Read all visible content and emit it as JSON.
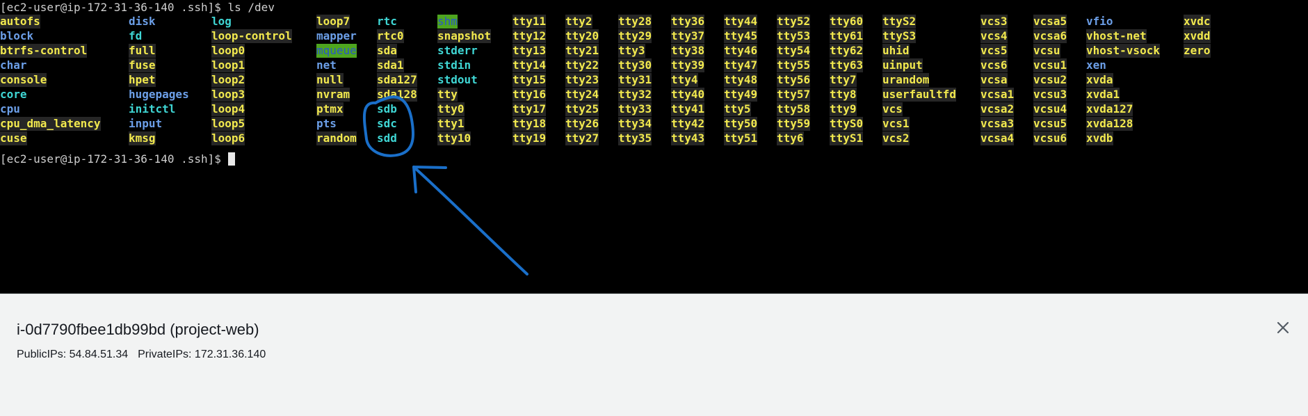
{
  "terminal": {
    "prompt_line": "[ec2-user@ip-172-31-36-140 .ssh]$ ls /dev",
    "final_prompt": "[ec2-user@ip-172-31-36-140 .ssh]$ ",
    "rows_per_column": 9,
    "columns": [
      [
        [
          "autofs",
          "dev"
        ],
        [
          "block",
          "dir"
        ],
        [
          "btrfs-control",
          "dev"
        ],
        [
          "char",
          "dir"
        ],
        [
          "console",
          "dev"
        ],
        [
          "core",
          "link"
        ],
        [
          "cpu",
          "dir"
        ],
        [
          "cpu_dma_latency",
          "dev"
        ],
        [
          "cuse",
          "dev"
        ]
      ],
      [
        [
          "disk",
          "dir"
        ],
        [
          "fd",
          "link"
        ],
        [
          "full",
          "dev"
        ],
        [
          "fuse",
          "dev"
        ],
        [
          "hpet",
          "dev"
        ],
        [
          "hugepages",
          "dir"
        ],
        [
          "initctl",
          "link"
        ],
        [
          "input",
          "dir"
        ],
        [
          "kmsg",
          "dev"
        ]
      ],
      [
        [
          "log",
          "link"
        ],
        [
          "loop-control",
          "dev"
        ],
        [
          "loop0",
          "dev"
        ],
        [
          "loop1",
          "dev"
        ],
        [
          "loop2",
          "dev"
        ],
        [
          "loop3",
          "dev"
        ],
        [
          "loop4",
          "dev"
        ],
        [
          "loop5",
          "dev"
        ],
        [
          "loop6",
          "dev"
        ]
      ],
      [
        [
          "loop7",
          "dev"
        ],
        [
          "mapper",
          "dir"
        ],
        [
          "mqueue",
          "sticky"
        ],
        [
          "net",
          "dir"
        ],
        [
          "null",
          "dev"
        ],
        [
          "nvram",
          "dev"
        ],
        [
          "ptmx",
          "dev"
        ],
        [
          "pts",
          "dir"
        ],
        [
          "random",
          "dev"
        ]
      ],
      [
        [
          "rtc",
          "link"
        ],
        [
          "rtc0",
          "dev"
        ],
        [
          "sda",
          "dev"
        ],
        [
          "sda1",
          "dev"
        ],
        [
          "sda127",
          "dev"
        ],
        [
          "sda128",
          "dev"
        ],
        [
          "sdb",
          "link"
        ],
        [
          "sdc",
          "link"
        ],
        [
          "sdd",
          "link"
        ]
      ],
      [
        [
          "shm",
          "sticky"
        ],
        [
          "snapshot",
          "dev"
        ],
        [
          "stderr",
          "link"
        ],
        [
          "stdin",
          "link"
        ],
        [
          "stdout",
          "link"
        ],
        [
          "tty",
          "dev"
        ],
        [
          "tty0",
          "dev"
        ],
        [
          "tty1",
          "dev"
        ],
        [
          "tty10",
          "dev"
        ]
      ],
      [
        [
          "tty11",
          "dev"
        ],
        [
          "tty12",
          "dev"
        ],
        [
          "tty13",
          "dev"
        ],
        [
          "tty14",
          "dev"
        ],
        [
          "tty15",
          "dev"
        ],
        [
          "tty16",
          "dev"
        ],
        [
          "tty17",
          "dev"
        ],
        [
          "tty18",
          "dev"
        ],
        [
          "tty19",
          "dev"
        ]
      ],
      [
        [
          "tty2",
          "dev"
        ],
        [
          "tty20",
          "dev"
        ],
        [
          "tty21",
          "dev"
        ],
        [
          "tty22",
          "dev"
        ],
        [
          "tty23",
          "dev"
        ],
        [
          "tty24",
          "dev"
        ],
        [
          "tty25",
          "dev"
        ],
        [
          "tty26",
          "dev"
        ],
        [
          "tty27",
          "dev"
        ]
      ],
      [
        [
          "tty28",
          "dev"
        ],
        [
          "tty29",
          "dev"
        ],
        [
          "tty3",
          "dev"
        ],
        [
          "tty30",
          "dev"
        ],
        [
          "tty31",
          "dev"
        ],
        [
          "tty32",
          "dev"
        ],
        [
          "tty33",
          "dev"
        ],
        [
          "tty34",
          "dev"
        ],
        [
          "tty35",
          "dev"
        ]
      ],
      [
        [
          "tty36",
          "dev"
        ],
        [
          "tty37",
          "dev"
        ],
        [
          "tty38",
          "dev"
        ],
        [
          "tty39",
          "dev"
        ],
        [
          "tty4",
          "dev"
        ],
        [
          "tty40",
          "dev"
        ],
        [
          "tty41",
          "dev"
        ],
        [
          "tty42",
          "dev"
        ],
        [
          "tty43",
          "dev"
        ]
      ],
      [
        [
          "tty44",
          "dev"
        ],
        [
          "tty45",
          "dev"
        ],
        [
          "tty46",
          "dev"
        ],
        [
          "tty47",
          "dev"
        ],
        [
          "tty48",
          "dev"
        ],
        [
          "tty49",
          "dev"
        ],
        [
          "tty5",
          "dev"
        ],
        [
          "tty50",
          "dev"
        ],
        [
          "tty51",
          "dev"
        ]
      ],
      [
        [
          "tty52",
          "dev"
        ],
        [
          "tty53",
          "dev"
        ],
        [
          "tty54",
          "dev"
        ],
        [
          "tty55",
          "dev"
        ],
        [
          "tty56",
          "dev"
        ],
        [
          "tty57",
          "dev"
        ],
        [
          "tty58",
          "dev"
        ],
        [
          "tty59",
          "dev"
        ],
        [
          "tty6",
          "dev"
        ]
      ],
      [
        [
          "tty60",
          "dev"
        ],
        [
          "tty61",
          "dev"
        ],
        [
          "tty62",
          "dev"
        ],
        [
          "tty63",
          "dev"
        ],
        [
          "tty7",
          "dev"
        ],
        [
          "tty8",
          "dev"
        ],
        [
          "tty9",
          "dev"
        ],
        [
          "ttyS0",
          "dev"
        ],
        [
          "ttyS1",
          "dev"
        ]
      ],
      [
        [
          "ttyS2",
          "dev"
        ],
        [
          "ttyS3",
          "dev"
        ],
        [
          "uhid",
          "dev"
        ],
        [
          "uinput",
          "dev"
        ],
        [
          "urandom",
          "dev"
        ],
        [
          "userfaultfd",
          "dev"
        ],
        [
          "vcs",
          "dev"
        ],
        [
          "vcs1",
          "dev"
        ],
        [
          "vcs2",
          "dev"
        ]
      ],
      [
        [
          "vcs3",
          "dev"
        ],
        [
          "vcs4",
          "dev"
        ],
        [
          "vcs5",
          "dev"
        ],
        [
          "vcs6",
          "dev"
        ],
        [
          "vcsa",
          "dev"
        ],
        [
          "vcsa1",
          "dev"
        ],
        [
          "vcsa2",
          "dev"
        ],
        [
          "vcsa3",
          "dev"
        ],
        [
          "vcsa4",
          "dev"
        ]
      ],
      [
        [
          "vcsa5",
          "dev"
        ],
        [
          "vcsa6",
          "dev"
        ],
        [
          "vcsu",
          "dev"
        ],
        [
          "vcsu1",
          "dev"
        ],
        [
          "vcsu2",
          "dev"
        ],
        [
          "vcsu3",
          "dev"
        ],
        [
          "vcsu4",
          "dev"
        ],
        [
          "vcsu5",
          "dev"
        ],
        [
          "vcsu6",
          "dev"
        ]
      ],
      [
        [
          "vfio",
          "dir"
        ],
        [
          "vhost-net",
          "dev"
        ],
        [
          "vhost-vsock",
          "dev"
        ],
        [
          "xen",
          "dir"
        ],
        [
          "xvda",
          "dev"
        ],
        [
          "xvda1",
          "dev"
        ],
        [
          "xvda127",
          "dev"
        ],
        [
          "xvda128",
          "dev"
        ],
        [
          "xvdb",
          "dev"
        ]
      ],
      [
        [
          "xvdc",
          "dev"
        ],
        [
          "xvdd",
          "dev"
        ],
        [
          "zero",
          "dev"
        ]
      ]
    ],
    "colors": {
      "background": "#000000",
      "device": "#f2e94e",
      "directory": "#6c9fe8",
      "symlink": "#3fd6d4",
      "annotation": "#1a6fc9"
    }
  },
  "info_panel": {
    "instance_title": "i-0d7790fbee1db99bd (project-web)",
    "public_ips": "PublicIPs: 54.84.51.34",
    "private_ips": "PrivateIPs: 172.31.36.140",
    "close_icon": "close-icon"
  }
}
